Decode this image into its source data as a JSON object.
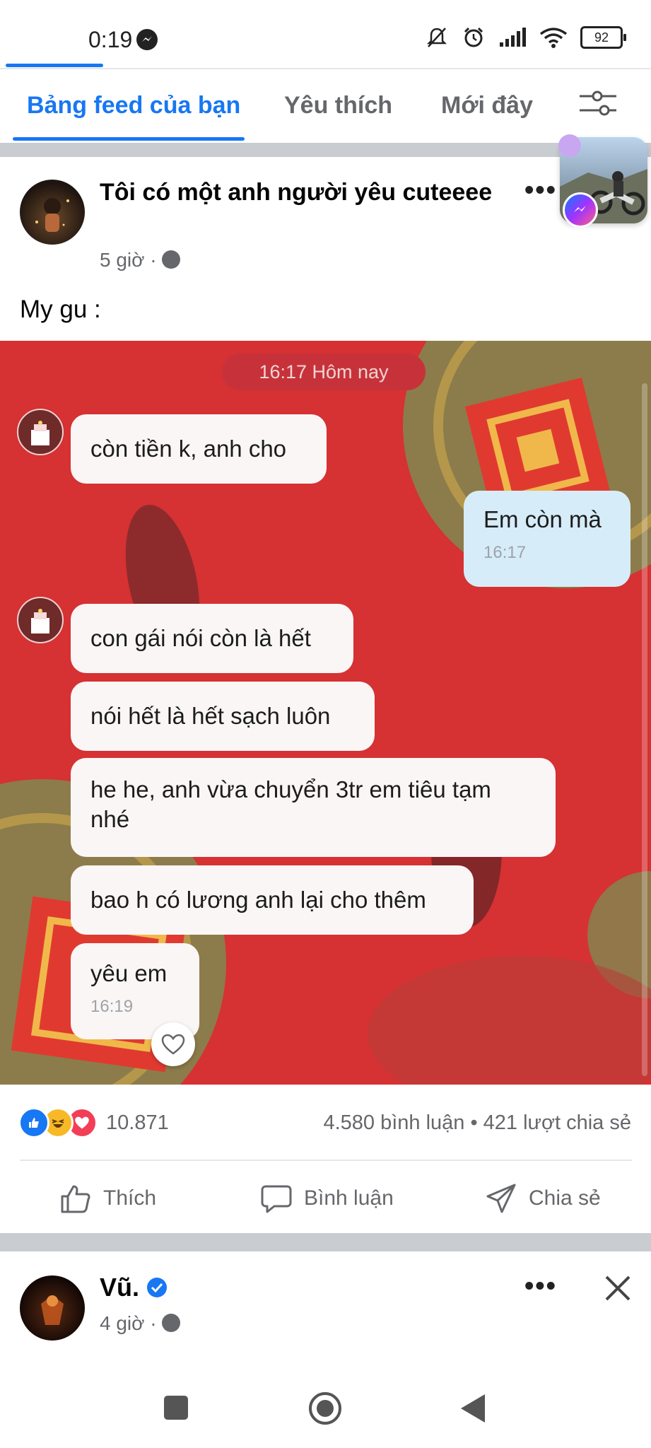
{
  "status_bar": {
    "time": "0:19",
    "battery": "92"
  },
  "tabs": [
    {
      "label": "Bảng feed của bạn",
      "active": true
    },
    {
      "label": "Yêu thích",
      "active": false
    },
    {
      "label": "Mới đây",
      "active": false
    }
  ],
  "post": {
    "author_title": "Tôi có một anh người yêu cuteeee",
    "time": "5 giờ ·",
    "caption": "My gu :",
    "chat": {
      "date_header": "16:17 Hôm nay",
      "messages": [
        {
          "from": "them",
          "text": "còn tiền k, anh cho"
        },
        {
          "from": "me",
          "text": "Em còn mà",
          "time": "16:17"
        },
        {
          "from": "them",
          "text": "con gái nói còn là hết"
        },
        {
          "from": "them",
          "text": "nói hết là hết sạch luôn"
        },
        {
          "from": "them",
          "text": "he he, anh vừa chuyển 3tr em tiêu tạm nhé"
        },
        {
          "from": "them",
          "text": "bao h có lương anh lại cho thêm"
        },
        {
          "from": "them",
          "text": "yêu em",
          "time": "16:19"
        }
      ]
    },
    "reactions_count": "10.871",
    "comments_shares": "4.580 bình luận • 421 lượt chia sẻ",
    "actions": {
      "like": "Thích",
      "comment": "Bình luận",
      "share": "Chia sẻ"
    }
  },
  "next_post": {
    "author": "Vũ.",
    "time": "4 giờ ·"
  },
  "colors": {
    "accent": "#1877f2",
    "chat_bg": "#d63133"
  }
}
